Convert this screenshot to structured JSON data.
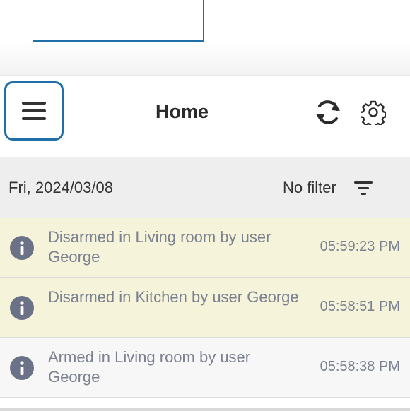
{
  "header": {
    "title": "Home",
    "menu_icon": "hamburger-menu-icon",
    "refresh_icon": "refresh-icon",
    "settings_icon": "gear-icon"
  },
  "filter_bar": {
    "date": "Fri, 2024/03/08",
    "filter_label": "No filter",
    "filter_icon": "filter-icon"
  },
  "events": [
    {
      "text": "Disarmed in Living room by user George",
      "time": "05:59:23 PM",
      "highlighted": true
    },
    {
      "text": "Disarmed in Kitchen by user George",
      "time": "05:58:51 PM",
      "highlighted": true
    },
    {
      "text": "Armed in Living room by user George",
      "time": "05:58:38 PM",
      "highlighted": false
    }
  ],
  "colors": {
    "callout": "#1f6fa8",
    "highlight_row": "#f5f3d9",
    "info_icon": "#6b7287"
  }
}
